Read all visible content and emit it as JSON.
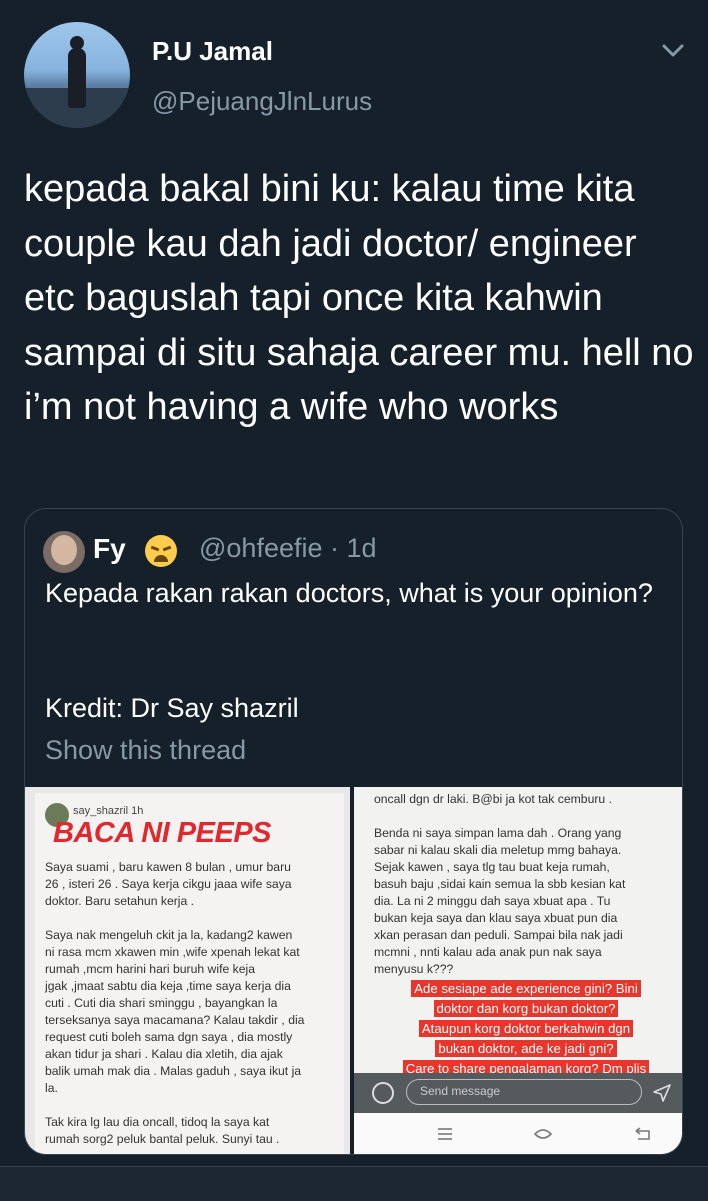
{
  "tweet": {
    "author_name": "P.U Jamal",
    "author_handle": "@PejuangJlnLurus",
    "text": "kepada bakal bini ku: kalau time kita couple kau dah jadi doctor/ engineer etc baguslah tapi once kita kahwin sampai di situ sahaja career mu. hell no i’m not having a wife who works",
    "menu_icon": "chevron-down-icon"
  },
  "quote": {
    "author_name": "Fy",
    "author_emoji": "😩",
    "author_handle_time": "@ohfeefie · 1d",
    "text": "Kepada rakan rakan doctors, what is your opinion?",
    "credit": "Kredit: Dr Say shazril",
    "show_thread": "Show this thread"
  },
  "image_left": {
    "username": "say_shazril  1h",
    "headline": "BACA NI PEEPS",
    "body": "Saya suami , baru kawen 8 bulan , umur baru\n26 , isteri 26 . Saya kerja cikgu jaaa wife saya\ndoktor. Baru setahun kerja .\n\nSaya nak mengeluh ckit ja la, kadang2 kawen\nni rasa mcm xkawen min ,wife xpenah lekat kat\nrumah ,mcm harini hari buruh wife keja\njgak ,jmaat sabtu dia keja ,time saya kerja dia\ncuti . Cuti dia shari sminggu , bayangkan la\nterseksanya saya macamana? Kalau takdir , dia\nrequest cuti boleh sama dgn saya , dia mostly\nakan tidur ja shari . Kalau dia xletih, dia ajak\nbalik umah mak dia . Malas gaduh , saya ikut ja\nla.\n\nTak kira lg lau dia oncall, tidoq la saya kat\nrumah sorg2 peluk bantal peluk. Sunyi tau ."
  },
  "image_right": {
    "body": "oncall dgn dr laki. B@bi ja kot tak cemburu .\n\nBenda ni saya simpan lama dah . Orang yang\nsabar ni kalau skali dia meletup mmg bahaya.\nSejak kawen , saya tlg tau buat keja rumah,\nbasuh baju ,sidai kain semua la sbb kesian kat\ndia. La ni 2 minggu dah saya xbuat apa . Tu\nbukan keja saya dan klau saya xbuat pun dia\nxkan perasan dan peduli. Sampai bila nak jadi\nmcmni , nnti kalau ada anak pun nak saya\nmenyusu k???",
    "highlight_lines": [
      "Ade sesiape ade experience gini? Bini",
      "doktor dan korg bukan doktor?",
      "Ataupun korg doktor berkahwin dgn",
      "bukan doktor, ade ke jadi gni?",
      "Care to share pengalaman korg? Dm plis"
    ],
    "send_placeholder": "Send message"
  },
  "colors": {
    "background": "#15202b",
    "secondary_text": "#8899a6",
    "border": "#38444d",
    "highlight_red": "#e8362c",
    "headline_red": "#e0282e"
  }
}
